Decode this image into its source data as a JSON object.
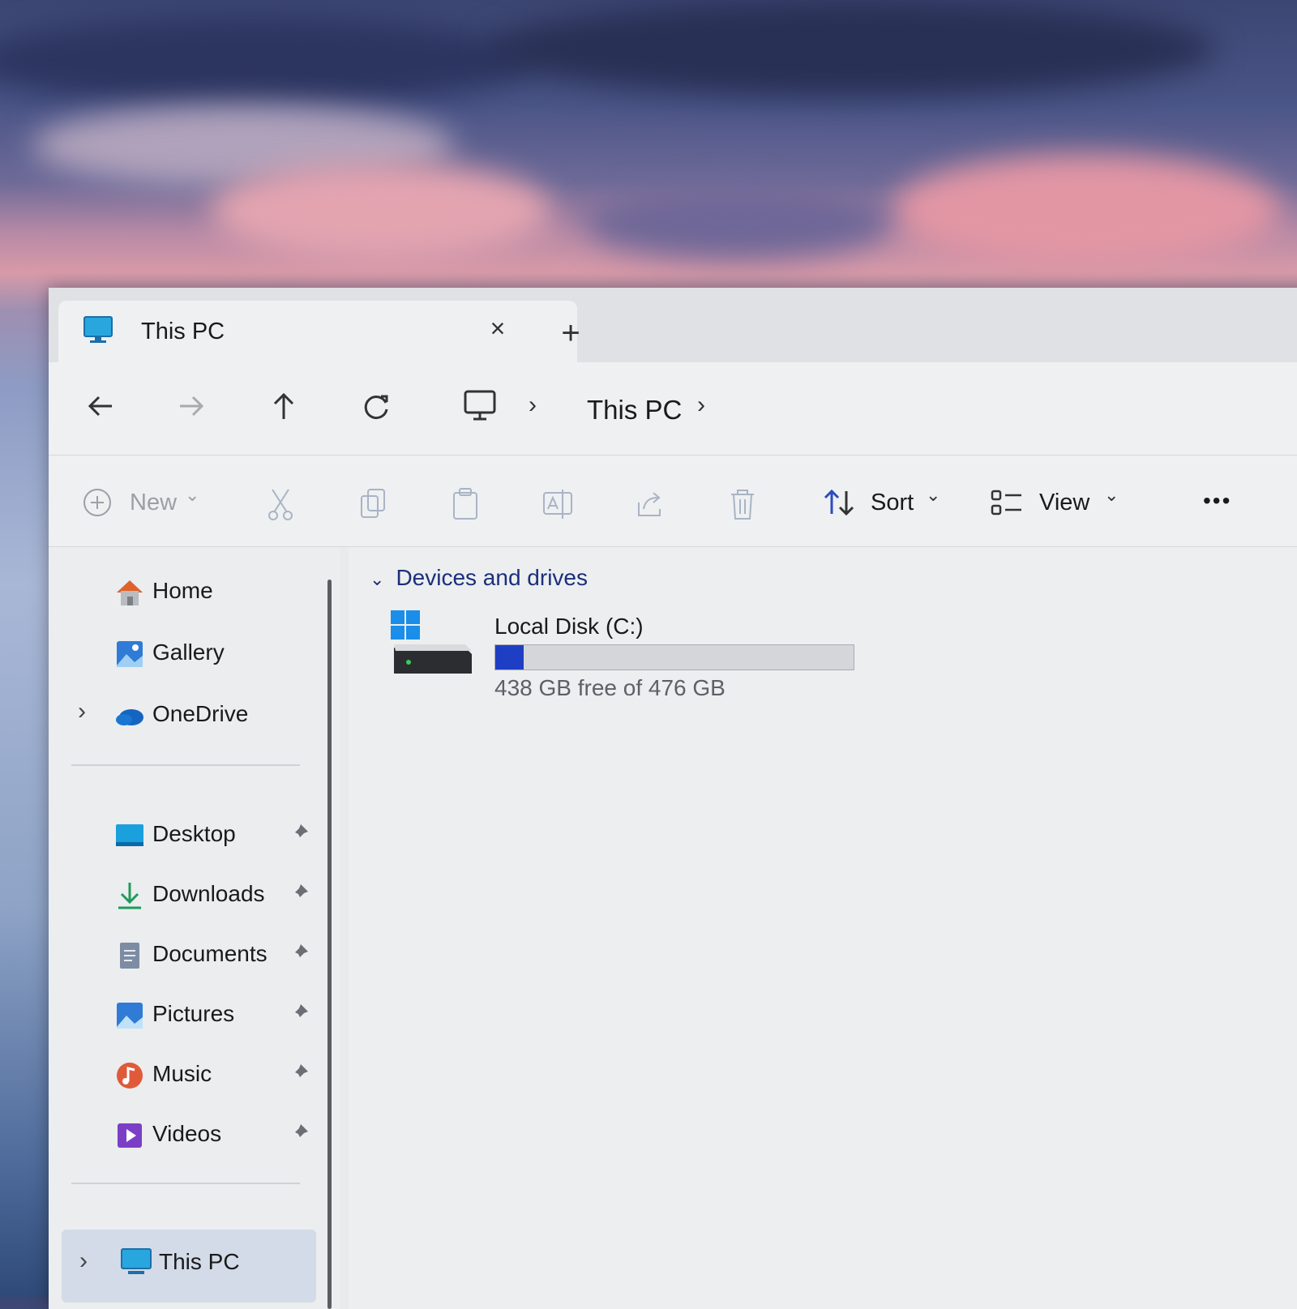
{
  "tab": {
    "title": "This PC",
    "close_symbol": "×",
    "new_tab_symbol": "+"
  },
  "breadcrumb": {
    "location": "This PC",
    "separator": "›"
  },
  "commands": {
    "new_label": "New",
    "sort_label": "Sort",
    "view_label": "View",
    "more_symbol": "•••",
    "dropdown_symbol": "⌄"
  },
  "sidebar": {
    "top_items": [
      {
        "label": "Home",
        "icon": "home-icon"
      },
      {
        "label": "Gallery",
        "icon": "gallery-icon"
      },
      {
        "label": "OneDrive",
        "icon": "onedrive-icon"
      }
    ],
    "quick_access": [
      {
        "label": "Desktop",
        "icon": "desktop-icon"
      },
      {
        "label": "Downloads",
        "icon": "downloads-icon"
      },
      {
        "label": "Documents",
        "icon": "documents-icon"
      },
      {
        "label": "Pictures",
        "icon": "pictures-icon"
      },
      {
        "label": "Music",
        "icon": "music-icon"
      },
      {
        "label": "Videos",
        "icon": "videos-icon"
      }
    ],
    "bottom_item": {
      "label": "This PC",
      "icon": "monitor-icon",
      "selected": true
    }
  },
  "content": {
    "group_header": "Devices and drives",
    "drive": {
      "name": "Local Disk (C:)",
      "free_text": "438 GB free of 476 GB",
      "used_fraction": 0.08
    }
  },
  "colors": {
    "accent": "#1e3fc4",
    "group_header": "#1b2f7a"
  }
}
